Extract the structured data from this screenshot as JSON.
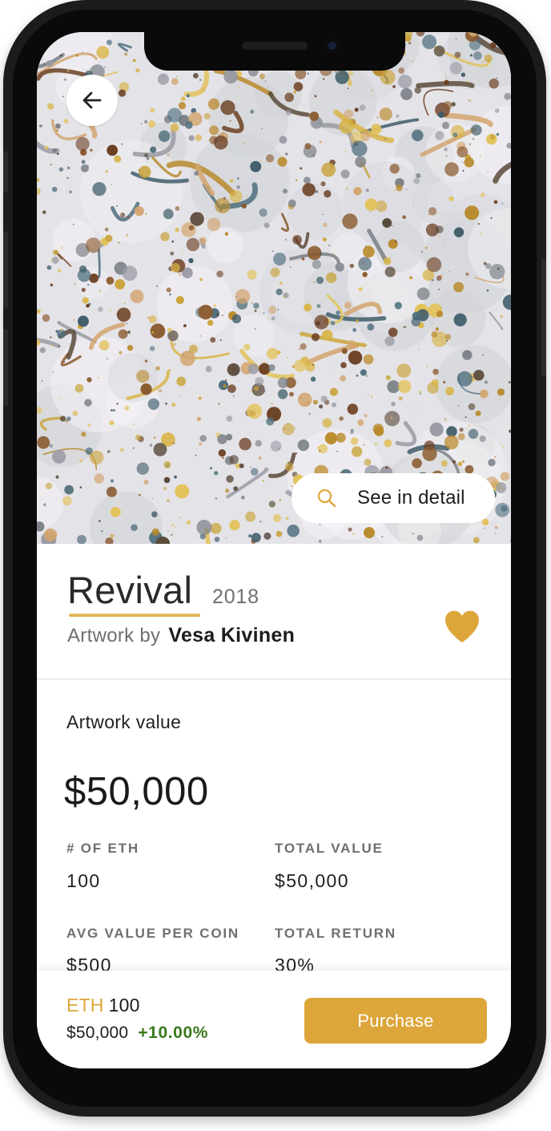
{
  "artwork": {
    "back_icon": "arrow-left-icon",
    "detail_icon": "search-icon",
    "detail_label": "See in detail"
  },
  "info": {
    "title": "Revival",
    "year": "2018",
    "byline_prefix": "Artwork by",
    "artist": "Vesa Kivinen",
    "favorite_icon": "heart-icon",
    "favorited": true
  },
  "value": {
    "section_title": "Artwork value",
    "amount": "$50,000",
    "stats": [
      {
        "label": "# OF ETH",
        "value": "100"
      },
      {
        "label": "TOTAL VALUE",
        "value": "$50,000"
      },
      {
        "label": "AVG VALUE PER COIN",
        "value": "$500"
      },
      {
        "label": "TOTAL RETURN",
        "value": "30%"
      }
    ]
  },
  "footer": {
    "currency": "ETH",
    "amount": "100",
    "price": "$50,000",
    "change": "+10.00%",
    "purchase_label": "Purchase"
  },
  "colors": {
    "accent": "#dda63a",
    "positive": "#3b7a1d",
    "title_underline": "#e3b754"
  }
}
